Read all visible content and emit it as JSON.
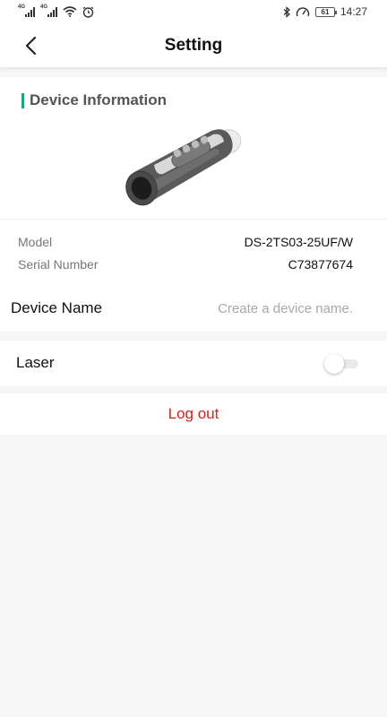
{
  "status_bar": {
    "signal_1_label": "4G",
    "signal_2_label": "4G",
    "battery": "61",
    "time": "14:27",
    "icons": [
      "signal-icon",
      "signal-icon",
      "wifi-icon",
      "alarm-icon",
      "bluetooth-icon",
      "speedometer-icon",
      "battery-icon"
    ]
  },
  "header": {
    "title": "Setting",
    "back_icon": "chevron-left-icon"
  },
  "device_info": {
    "section_title": "Device Information",
    "accent_color": "#1ba672",
    "image": "thermal-monocular-device-image",
    "model_label": "Model",
    "model_value": "DS-2TS03-25UF/W",
    "serial_label": "Serial Number",
    "serial_value": "C73877674"
  },
  "device_name": {
    "label": "Device Name",
    "value": "",
    "placeholder": "Create a device name."
  },
  "laser": {
    "label": "Laser",
    "enabled": false
  },
  "logout": {
    "label": "Log out",
    "color": "#d81e1e"
  }
}
